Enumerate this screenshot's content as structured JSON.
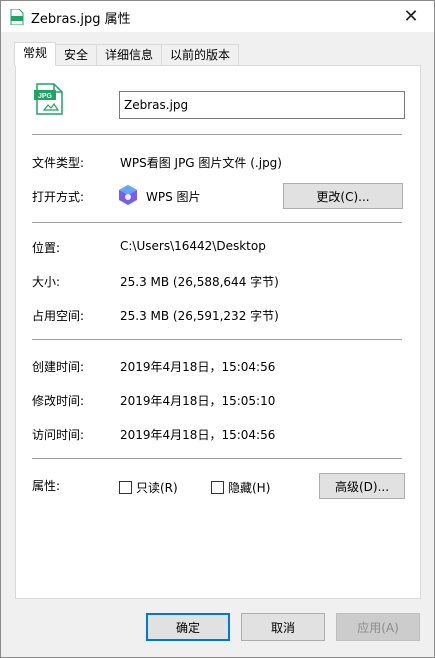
{
  "window": {
    "title": "Zebras.jpg 属性",
    "close_glyph": "✕"
  },
  "tabs": [
    {
      "label": "常规",
      "active": true
    },
    {
      "label": "安全",
      "active": false
    },
    {
      "label": "详细信息",
      "active": false
    },
    {
      "label": "以前的版本",
      "active": false
    }
  ],
  "file": {
    "icon_label": "JPG",
    "name": "Zebras.jpg"
  },
  "type_row": {
    "label": "文件类型:",
    "value": "WPS看图 JPG 图片文件 (.jpg)"
  },
  "open_row": {
    "label": "打开方式:",
    "value": "WPS 图片",
    "change_button": "更改(C)..."
  },
  "location_row": {
    "label": "位置:",
    "value": "C:\\Users\\16442\\Desktop"
  },
  "size_row": {
    "label": "大小:",
    "value": "25.3 MB (26,588,644 字节)"
  },
  "disk_size_row": {
    "label": "占用空间:",
    "value": "25.3 MB (26,591,232 字节)"
  },
  "created_row": {
    "label": "创建时间:",
    "value": "2019年4月18日，15:04:56"
  },
  "modified_row": {
    "label": "修改时间:",
    "value": "2019年4月18日，15:05:10"
  },
  "accessed_row": {
    "label": "访问时间:",
    "value": "2019年4月18日，15:04:56"
  },
  "attributes_row": {
    "label": "属性:",
    "readonly_label": "只读(R)",
    "readonly_checked": false,
    "hidden_label": "隐藏(H)",
    "hidden_checked": false,
    "advanced_button": "高级(D)..."
  },
  "footer": {
    "ok": "确定",
    "cancel": "取消",
    "apply": "应用(A)"
  },
  "colors": {
    "jpg_icon_green": "#21a366",
    "primary_border": "#0078d7",
    "wps_app_purple": "#7b5cf0"
  }
}
